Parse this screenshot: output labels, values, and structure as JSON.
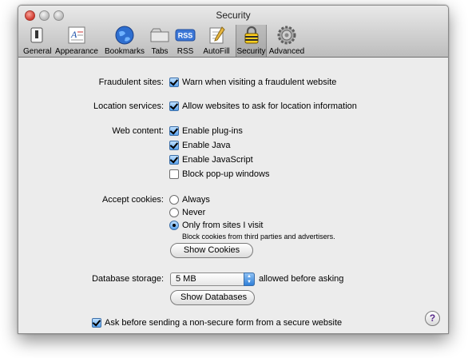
{
  "window": {
    "title": "Security"
  },
  "toolbar": {
    "items": [
      {
        "label": "General",
        "icon": "general-switch-icon"
      },
      {
        "label": "Appearance",
        "icon": "appearance-font-icon"
      },
      {
        "label": "Bookmarks",
        "icon": "bookmarks-globe-icon"
      },
      {
        "label": "Tabs",
        "icon": "tabs-icon"
      },
      {
        "label": "RSS",
        "icon": "rss-icon"
      },
      {
        "label": "AutoFill",
        "icon": "autofill-pencil-icon"
      },
      {
        "label": "Security",
        "icon": "security-lock-icon",
        "selected": true
      },
      {
        "label": "Advanced",
        "icon": "advanced-gear-icon"
      }
    ]
  },
  "settings": {
    "fraudulent_label": "Fraudulent sites:",
    "fraudulent_option": "Warn when visiting a fraudulent website",
    "location_label": "Location services:",
    "location_option": "Allow websites to ask for location information",
    "web_content_label": "Web content:",
    "web_content_options": [
      {
        "text": "Enable plug-ins",
        "checked": true
      },
      {
        "text": "Enable Java",
        "checked": true
      },
      {
        "text": "Enable JavaScript",
        "checked": true
      },
      {
        "text": "Block pop-up windows",
        "checked": false
      }
    ],
    "cookies_label": "Accept cookies:",
    "cookies_options": [
      {
        "text": "Always",
        "selected": false
      },
      {
        "text": "Never",
        "selected": false
      },
      {
        "text": "Only from sites I visit",
        "selected": true
      }
    ],
    "cookies_note": "Block cookies from third parties and advertisers.",
    "show_cookies_button": "Show Cookies",
    "database_label": "Database storage:",
    "database_value": "5 MB",
    "database_suffix": "allowed before asking",
    "show_databases_button": "Show Databases",
    "secure_form_option": "Ask before sending a non-secure form from a secure website"
  },
  "help_button": "?",
  "colors": {
    "checkbox_accent": "#5aa3ee",
    "help_glyph": "#5a2a8c"
  }
}
